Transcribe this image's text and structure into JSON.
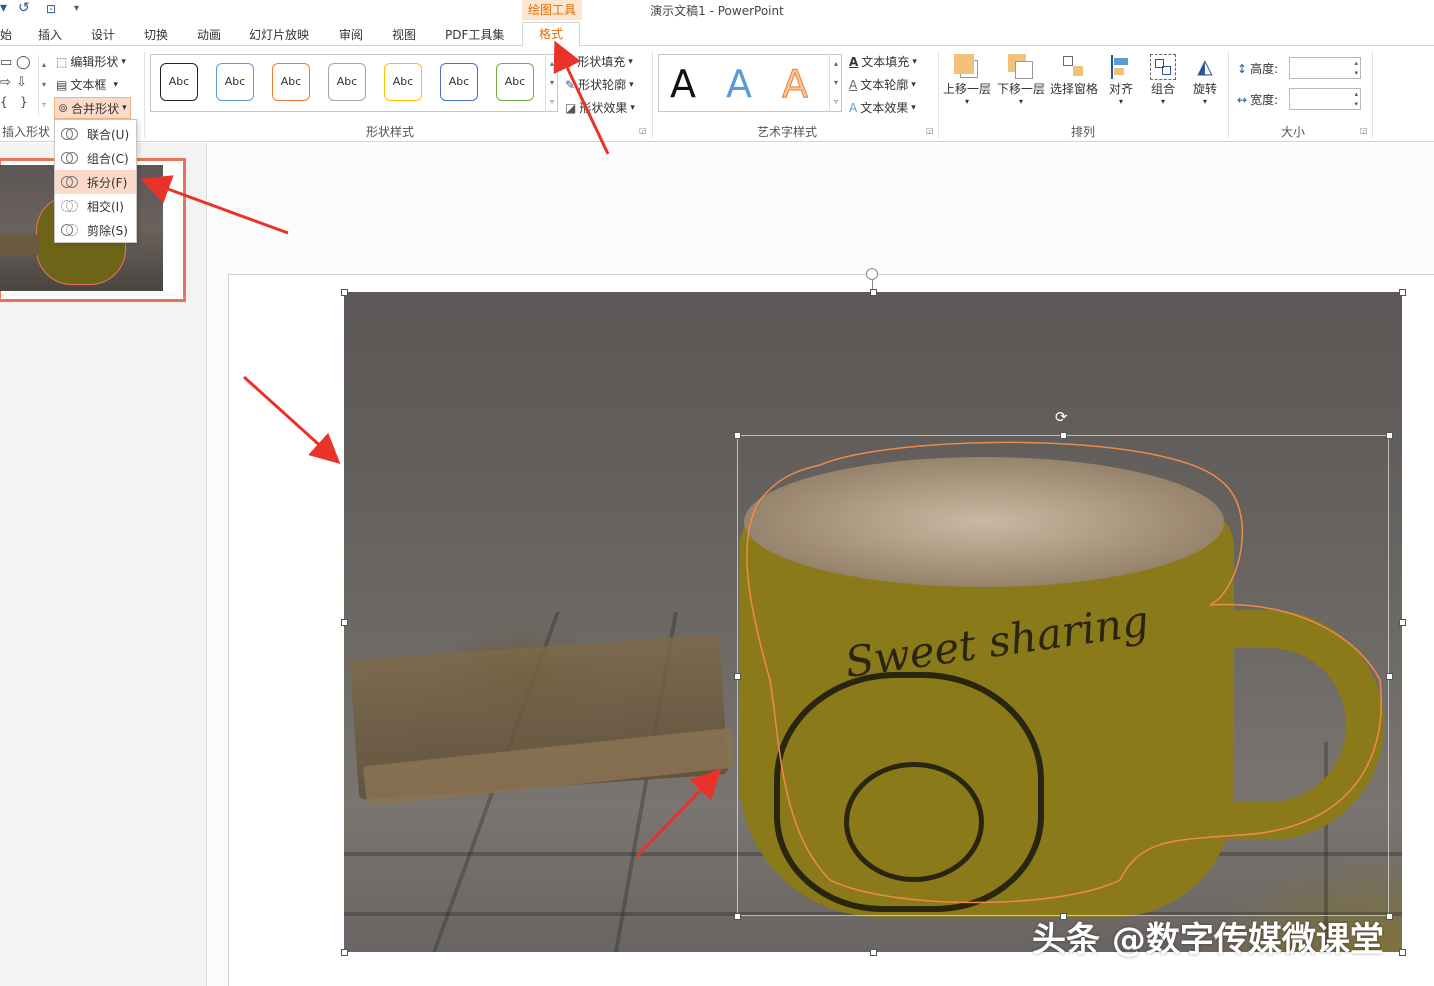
{
  "app": {
    "title": "演示文稿1 - PowerPoint",
    "context_group": "绘图工具"
  },
  "tabs": [
    {
      "label": "始"
    },
    {
      "label": "插入"
    },
    {
      "label": "设计"
    },
    {
      "label": "切换"
    },
    {
      "label": "动画"
    },
    {
      "label": "幻灯片放映"
    },
    {
      "label": "审阅"
    },
    {
      "label": "视图"
    },
    {
      "label": "PDF工具集"
    },
    {
      "label": "格式"
    }
  ],
  "ribbon": {
    "insert_shapes": {
      "label": "插入形状",
      "edit_shape": "编辑形状",
      "text_box": "文本框",
      "merge_shapes": "合并形状"
    },
    "shape_styles": {
      "label": "形状样式",
      "style_text": "Abc",
      "styles": [
        {
          "border": "#222222"
        },
        {
          "border": "#5b9bd5"
        },
        {
          "border": "#ed7d31"
        },
        {
          "border": "#a5a5a5"
        },
        {
          "border": "#ffc000"
        },
        {
          "border": "#4472c4"
        },
        {
          "border": "#70ad47"
        }
      ],
      "fill": "形状填充",
      "outline": "形状轮廓",
      "effects": "形状效果"
    },
    "wordart": {
      "label": "艺术字样式",
      "letters": [
        {
          "char": "A",
          "color": "#111111"
        },
        {
          "char": "A",
          "color": "#5b9bd5"
        },
        {
          "char": "A",
          "color": "#ed7d31"
        }
      ],
      "text_fill": "文本填充",
      "text_outline": "文本轮廓",
      "text_effects": "文本效果"
    },
    "arrange": {
      "label": "排列",
      "bring_forward": "上移一层",
      "send_backward": "下移一层",
      "selection_pane": "选择窗格",
      "align": "对齐",
      "group": "组合",
      "rotate": "旋转"
    },
    "size": {
      "label": "大小",
      "height": "高度:",
      "width": "宽度:"
    }
  },
  "merge_menu": {
    "items": [
      {
        "label": "联合(U)",
        "highlighted": false
      },
      {
        "label": "组合(C)",
        "highlighted": false
      },
      {
        "label": "拆分(F)",
        "highlighted": true
      },
      {
        "label": "相交(I)",
        "highlighted": false
      },
      {
        "label": "剪除(S)",
        "highlighted": false
      }
    ]
  },
  "slide": {
    "cup_text": "Sweet sharing",
    "watermark": "头条 @数字传媒微课堂"
  },
  "colors": {
    "accent_orange": "#e46c0a",
    "highlight_red": "#e8322a",
    "thumb_border": "#e8745a"
  }
}
